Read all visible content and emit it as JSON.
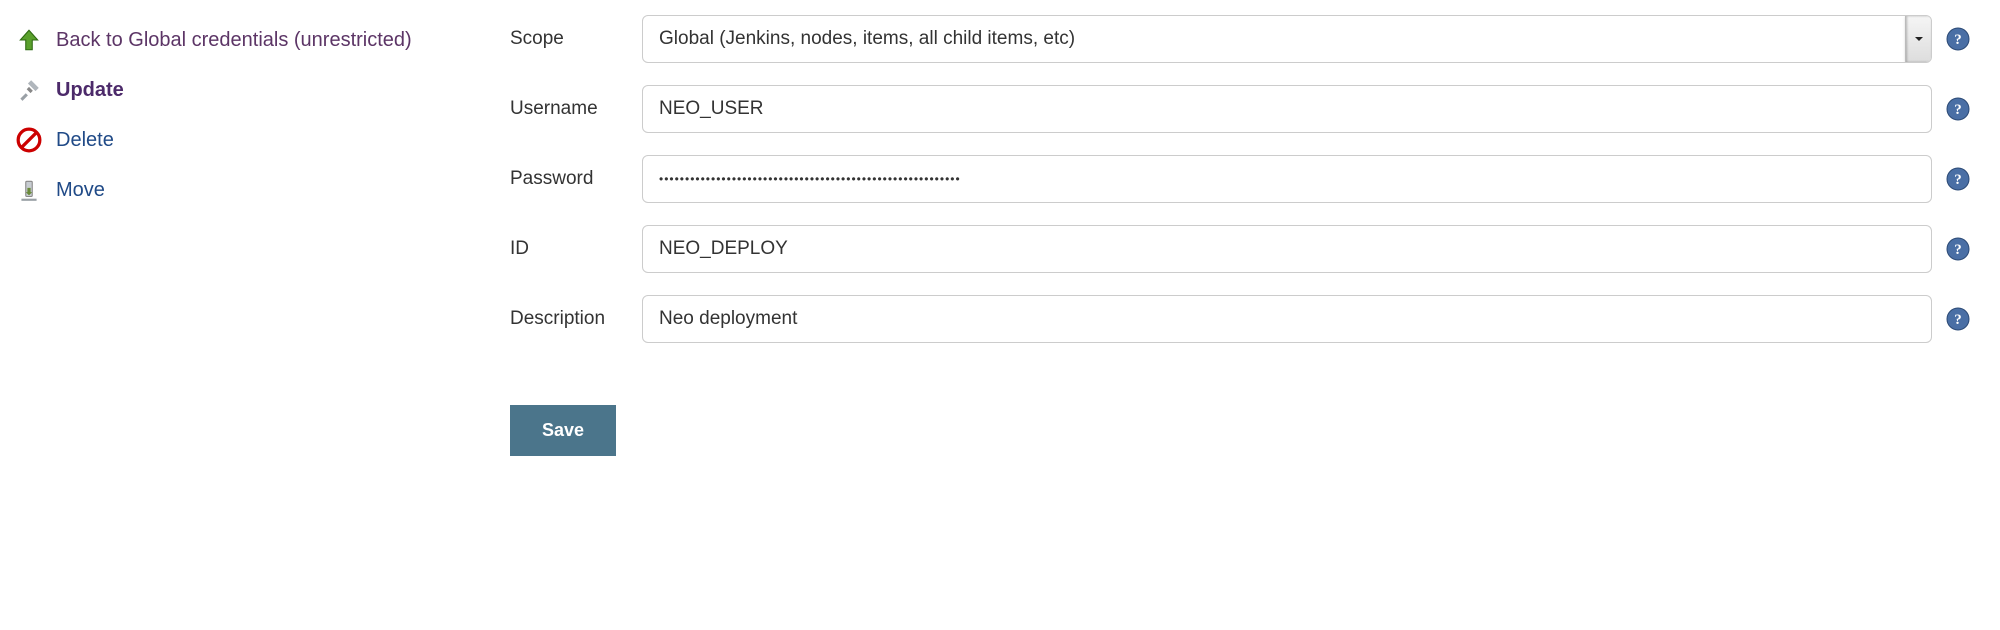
{
  "sidebar": {
    "back": {
      "label": "Back to Global credentials (unrestricted)"
    },
    "update": {
      "label": "Update"
    },
    "delete": {
      "label": "Delete"
    },
    "move": {
      "label": "Move"
    }
  },
  "form": {
    "scope": {
      "label": "Scope",
      "value": "Global (Jenkins, nodes, items, all child items, etc)"
    },
    "username": {
      "label": "Username",
      "value": "NEO_USER"
    },
    "password": {
      "label": "Password",
      "value": "••••••••••••••••••••••••••••••••••••••••••••••••••••••••••"
    },
    "id": {
      "label": "ID",
      "value": "NEO_DEPLOY"
    },
    "description": {
      "label": "Description",
      "value": "Neo deployment"
    }
  },
  "buttons": {
    "save": "Save"
  }
}
